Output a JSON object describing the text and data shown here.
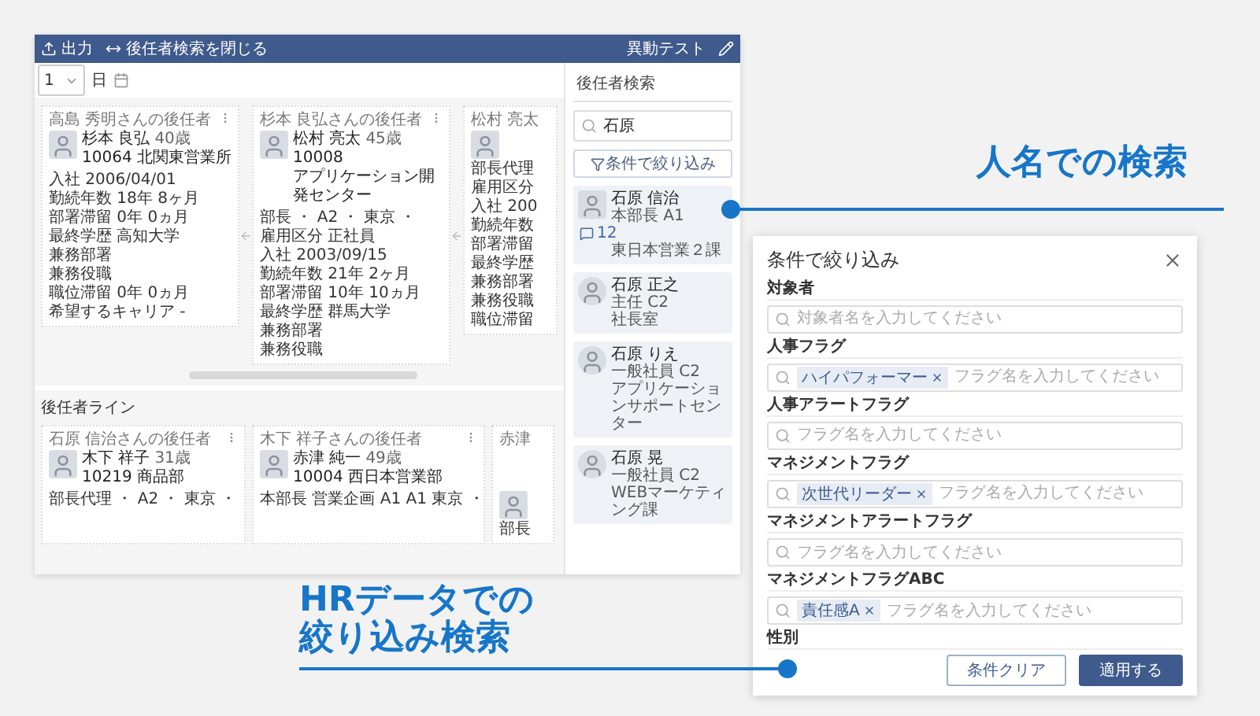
{
  "header": {
    "actions": [
      {
        "kind": "export",
        "label": "出力"
      },
      {
        "kind": "close-search",
        "label": "後任者検索を閉じる"
      }
    ],
    "title": "異動テスト"
  },
  "date_picker": {
    "value": "1",
    "unit": "日"
  },
  "succession_cards": [
    {
      "caption": "高島 秀明さんの後任者",
      "name": "杉本 良弘",
      "age": "40歳",
      "lines": [
        "10064 北関東営業所"
      ],
      "details": [
        "入社 2006/04/01",
        "勤続年数 18年 8ヶ月",
        "部署滞留 0年 0ヵ月",
        "最終学歴 高知大学",
        "兼務部署",
        "兼務役職",
        "職位滞留 0年 0ヵ月",
        "希望するキャリア -"
      ]
    },
    {
      "caption": "杉本 良弘さんの後任者",
      "name": "松村 亮太",
      "age": "45歳",
      "lines": [
        "10008",
        "アプリケーション開発センター"
      ],
      "details": [
        "部長 ・ A2 ・ 東京 ・",
        "雇用区分 正社員",
        "入社 2003/09/15",
        "勤続年数 21年 2ヶ月",
        "部署滞留 10年 10ヵ月",
        "最終学歴 群馬大学",
        "兼務部署",
        "兼務役職"
      ]
    }
  ],
  "partial_card": {
    "caption": "松村 亮太",
    "details": [
      "部長代理",
      "雇用区分",
      "入社 200",
      "勤続年数",
      "部署滞留",
      "最終学歴",
      "兼務部署",
      "兼務役職",
      "職位滞留"
    ]
  },
  "succession_line": {
    "title": "後任者ライン",
    "cards": [
      {
        "caption": "石原 信治さんの後任者",
        "name": "木下 祥子",
        "age": "31歳",
        "lines": [
          "10219 商品部"
        ],
        "details": [
          "部長代理 ・ A2 ・ 東京 ・"
        ]
      },
      {
        "caption": "木下 祥子さんの後任者",
        "name": "赤津 純一",
        "age": "49歳",
        "lines": [
          "10004 西日本営業部"
        ],
        "details": [
          "本部長 営業企画 A1 A1 東京 ・"
        ]
      }
    ],
    "partial_card": {
      "caption": "赤津",
      "details": [
        "部長"
      ]
    }
  },
  "search_panel": {
    "title": "後任者検索",
    "query": "石原",
    "filter_button": "条件で絞り込み",
    "results": [
      {
        "name": "石原 信治",
        "role": "本部長 A1",
        "comments": "12",
        "dept": "東日本営業２課"
      },
      {
        "name": "石原 正之",
        "role": "主任 C2",
        "dept": "社長室"
      },
      {
        "name": "石原 りえ",
        "role": "一般社員 C2",
        "dept": "アプリケーションサポートセンター"
      },
      {
        "name": "石原 晃",
        "role": "一般社員 C2",
        "dept": "WEBマーケティング課"
      }
    ]
  },
  "filter_modal": {
    "title": "条件で絞り込み",
    "sections": [
      {
        "label": "対象者",
        "placeholder": "対象者名を入力してください"
      },
      {
        "label": "人事フラグ",
        "chips": [
          "ハイパフォーマー"
        ],
        "placeholder": "フラグ名を入力してください"
      },
      {
        "label": "人事アラートフラグ",
        "placeholder": "フラグ名を入力してください"
      },
      {
        "label": "マネジメントフラグ",
        "chips": [
          "次世代リーダー"
        ],
        "placeholder": "フラグ名を入力してください"
      },
      {
        "label": "マネジメントアラートフラグ",
        "placeholder": "フラグ名を入力してください"
      },
      {
        "label": "マネジメントフラグABC",
        "chips": [
          "責任感A"
        ],
        "placeholder": "フラグ名を入力してください"
      }
    ],
    "last_label": "性別",
    "buttons": [
      {
        "kind": "secondary",
        "label": "条件クリア"
      },
      {
        "kind": "primary",
        "label": "適用する"
      }
    ]
  },
  "callouts": [
    {
      "kind": "name-search",
      "lines": [
        "人名での検索"
      ]
    },
    {
      "kind": "hr-search",
      "lines": [
        "HRデータでの",
        "絞り込み検索"
      ]
    }
  ]
}
